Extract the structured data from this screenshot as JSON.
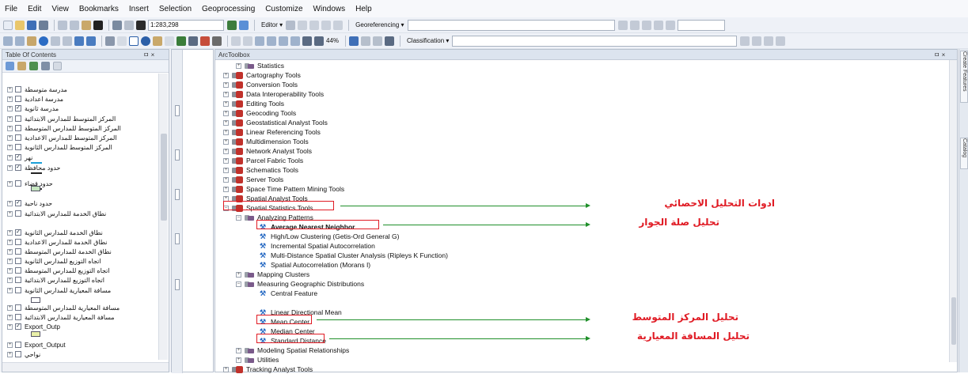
{
  "menu": [
    "File",
    "Edit",
    "View",
    "Bookmarks",
    "Insert",
    "Selection",
    "Geoprocessing",
    "Customize",
    "Windows",
    "Help"
  ],
  "toolbar": {
    "scale": "1:283,298",
    "editor_label": "Editor ▾",
    "georef_label": "Georeferencing ▾",
    "zoom_pct": "44%",
    "classification_label": "Classification ▾"
  },
  "toc": {
    "title": "Table Of Contents",
    "pin": "ㅁ ×",
    "layers": [
      {
        "label": "مدرسة متوسطة",
        "checked": false
      },
      {
        "label": "مدرسة اعدادية",
        "checked": false
      },
      {
        "label": "مدرسة ثانوية",
        "checked": true
      },
      {
        "label": "المركز المتوسط للمدارس الابتدائية",
        "checked": false
      },
      {
        "label": "المركز المتوسط للمدارس المتوسطة",
        "checked": false
      },
      {
        "label": "المركز المتوسط للمدارس الاعدادية",
        "checked": false
      },
      {
        "label": "المركز المتوسط للمدارس الثانوية",
        "checked": false
      },
      {
        "label": "نهر",
        "checked": true
      },
      {
        "label": "حدود محافظة",
        "checked": true
      },
      {
        "label": "حدود قضاء",
        "checked": false
      },
      {
        "label": "حدود ناحية",
        "checked": true
      },
      {
        "label": "نطاق الخدمة للمدارس الابتدائية",
        "checked": false
      },
      {
        "label": "نطاق الخدمة للمدارس الثانوية",
        "checked": true
      },
      {
        "label": "نطاق الخدمة للمدارس الاعدادية",
        "checked": false
      },
      {
        "label": "نطاق الخدمة للمدارس المتوسطة",
        "checked": false
      },
      {
        "label": "اتجاه التوزيع للمدارس الثانوية",
        "checked": false
      },
      {
        "label": "اتجاه التوزيع للمدارس المتوسطة",
        "checked": false
      },
      {
        "label": "اتجاه التوزيع للمدارس الابتدائية",
        "checked": false
      },
      {
        "label": "مسافة المعيارية للمدارس الثانوية",
        "checked": false
      },
      {
        "label": "مسافة المعيارية للمدارس المتوسطة",
        "checked": false
      },
      {
        "label": "مسافة المعيارية للمدارس الابتدائية",
        "checked": false
      },
      {
        "label": "Export_Outp",
        "checked": true
      },
      {
        "label": "Export_Output",
        "checked": false
      },
      {
        "label": "نواحي",
        "checked": false
      }
    ]
  },
  "toolbox": {
    "title": "ArcToolbox",
    "pin": "ㅁ ×",
    "items": [
      {
        "label": "Statistics",
        "kind": "set",
        "level": 1,
        "expander": "+"
      },
      {
        "label": "Cartography Tools",
        "kind": "box",
        "level": 0,
        "expander": "+"
      },
      {
        "label": "Conversion Tools",
        "kind": "box",
        "level": 0,
        "expander": "+"
      },
      {
        "label": "Data Interoperability Tools",
        "kind": "box",
        "level": 0,
        "expander": "+"
      },
      {
        "label": "Editing Tools",
        "kind": "box",
        "level": 0,
        "expander": "+"
      },
      {
        "label": "Geocoding Tools",
        "kind": "box",
        "level": 0,
        "expander": "+"
      },
      {
        "label": "Geostatistical Analyst Tools",
        "kind": "box",
        "level": 0,
        "expander": "+"
      },
      {
        "label": "Linear Referencing Tools",
        "kind": "box",
        "level": 0,
        "expander": "+"
      },
      {
        "label": "Multidimension Tools",
        "kind": "box",
        "level": 0,
        "expander": "+"
      },
      {
        "label": "Network Analyst Tools",
        "kind": "box",
        "level": 0,
        "expander": "+"
      },
      {
        "label": "Parcel Fabric Tools",
        "kind": "box",
        "level": 0,
        "expander": "+"
      },
      {
        "label": "Schematics Tools",
        "kind": "box",
        "level": 0,
        "expander": "+"
      },
      {
        "label": "Server Tools",
        "kind": "box",
        "level": 0,
        "expander": "+"
      },
      {
        "label": "Space Time Pattern Mining Tools",
        "kind": "box",
        "level": 0,
        "expander": "+"
      },
      {
        "label": "Spatial Analyst Tools",
        "kind": "box",
        "level": 0,
        "expander": "+"
      },
      {
        "label": "Spatial Statistics Tools",
        "kind": "box",
        "level": 0,
        "expander": "−"
      },
      {
        "label": "Analyzing Patterns",
        "kind": "set",
        "level": 1,
        "expander": "−"
      },
      {
        "label": "Average Nearest Neighbor",
        "kind": "tool",
        "level": 2,
        "bold": true
      },
      {
        "label": "High/Low Clustering (Getis-Ord General G)",
        "kind": "tool",
        "level": 2
      },
      {
        "label": "Incremental Spatial Autocorrelation",
        "kind": "tool",
        "level": 2
      },
      {
        "label": "Multi-Distance Spatial Cluster Analysis (Ripleys K Function)",
        "kind": "tool",
        "level": 2
      },
      {
        "label": "Spatial Autocorrelation (Morans I)",
        "kind": "tool",
        "level": 2
      },
      {
        "label": "Mapping Clusters",
        "kind": "set",
        "level": 1,
        "expander": "+"
      },
      {
        "label": "Measuring Geographic Distributions",
        "kind": "set",
        "level": 1,
        "expander": "−"
      },
      {
        "label": "Central Feature",
        "kind": "tool",
        "level": 2
      },
      {
        "label": "Linear Directional Mean",
        "kind": "tool",
        "level": 2
      },
      {
        "label": "Mean Center",
        "kind": "tool",
        "level": 2
      },
      {
        "label": "Median Center",
        "kind": "tool",
        "level": 2
      },
      {
        "label": "Standard Distance",
        "kind": "tool",
        "level": 2
      },
      {
        "label": "Modeling Spatial Relationships",
        "kind": "set",
        "level": 1,
        "expander": "+"
      },
      {
        "label": "Utilities",
        "kind": "set",
        "level": 1,
        "expander": "+"
      },
      {
        "label": "Tracking Analyst Tools",
        "kind": "box",
        "level": 0,
        "expander": "+"
      }
    ]
  },
  "annotations": [
    {
      "text": "ادوات التحليل الاحصائي"
    },
    {
      "text": "تحليل صلة الجوار"
    },
    {
      "text": "تحليل المركز المتوسط"
    },
    {
      "text": "تحليل المسافة المعيارية"
    }
  ],
  "dock": [
    "Create Features",
    "Catalog"
  ],
  "colors": {
    "highlight": "#e01b24",
    "arrow": "#1f8f2a",
    "note": "#e01b24"
  }
}
